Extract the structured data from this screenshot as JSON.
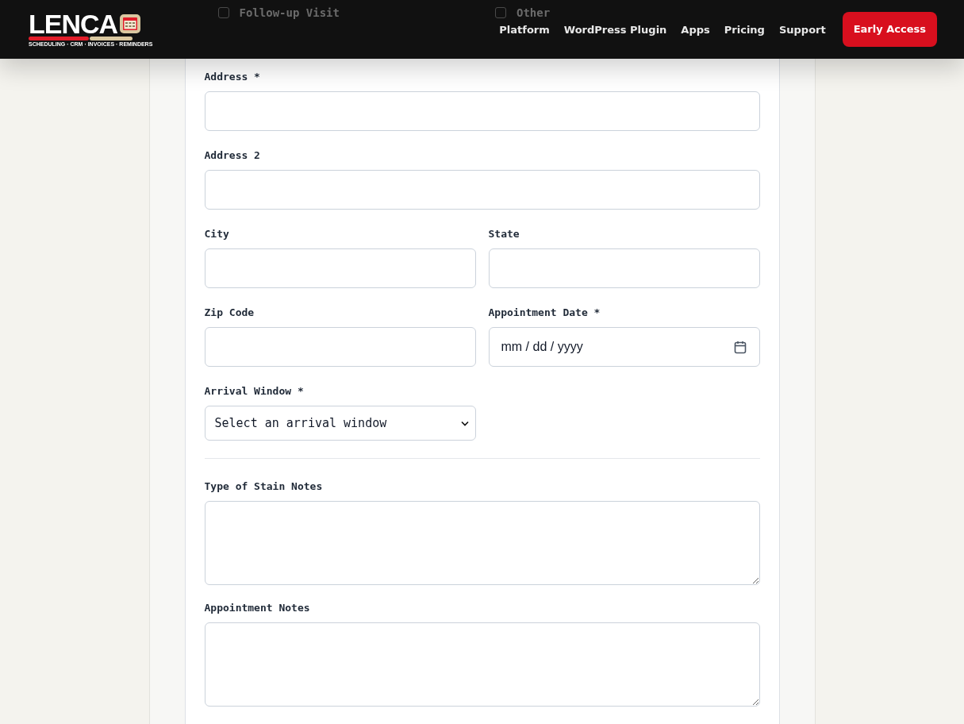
{
  "header": {
    "logo": {
      "wordmark": "LENCA",
      "tagline": "SCHEDULING · CRM · INVOICES · REMINDERS"
    },
    "nav": [
      {
        "label": "Platform"
      },
      {
        "label": "WordPress Plugin"
      },
      {
        "label": "Apps"
      },
      {
        "label": "Pricing"
      },
      {
        "label": "Support"
      }
    ],
    "cta": "Early Access"
  },
  "form": {
    "checkboxes": [
      {
        "label": "Follow-up Visit",
        "checked": false
      },
      {
        "label": "Other",
        "checked": false
      }
    ],
    "rows": [
      {
        "kind": "fields",
        "fields": [
          {
            "kind": "text",
            "label": "Address *"
          }
        ]
      },
      {
        "kind": "fields",
        "fields": [
          {
            "kind": "text",
            "label": "Address 2"
          }
        ]
      },
      {
        "kind": "fields",
        "fields": [
          {
            "kind": "text",
            "label": "City"
          },
          {
            "kind": "text",
            "label": "State"
          }
        ]
      },
      {
        "kind": "fields",
        "fields": [
          {
            "kind": "text",
            "label": "Zip Code"
          },
          {
            "kind": "date",
            "label": "Appointment Date *",
            "placeholder": "mm / dd / yyyy"
          }
        ]
      },
      {
        "kind": "fields",
        "fields": [
          {
            "kind": "select",
            "label": "Arrival Window *",
            "value": "Select an arrival window"
          }
        ]
      },
      {
        "kind": "divider"
      },
      {
        "kind": "fields",
        "fields": [
          {
            "kind": "textarea",
            "label": "Type of Stain Notes"
          }
        ]
      },
      {
        "kind": "fields",
        "fields": [
          {
            "kind": "textarea",
            "label": "Appointment Notes"
          }
        ]
      }
    ]
  }
}
